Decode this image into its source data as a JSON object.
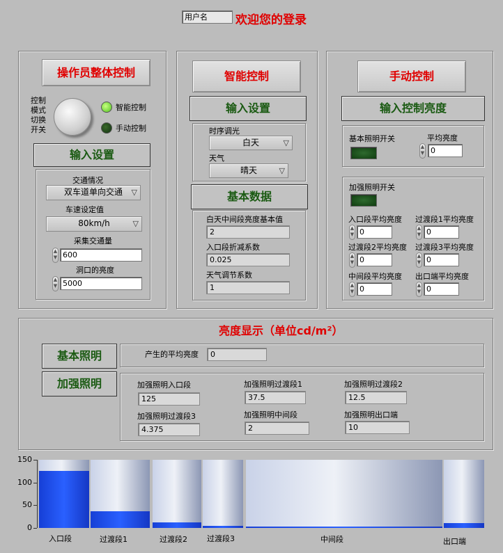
{
  "header": {
    "username_value": "用户名",
    "welcome": "欢迎您的登录"
  },
  "operator": {
    "title": "操作员整体控制",
    "switch_label": "控制模式切换开关",
    "options": [
      {
        "label": "智能控制",
        "on": true
      },
      {
        "label": "手动控制",
        "on": false
      }
    ],
    "input_header": "输入设置",
    "traffic_label": "交通情况",
    "traffic_value": "双车道单向交通",
    "speed_label": "车速设定值",
    "speed_value": "80km/h",
    "collect_label": "采集交通量",
    "collect_value": "600",
    "portal_label": "洞口的亮度",
    "portal_value": "5000"
  },
  "smart": {
    "title": "智能控制",
    "input_header": "输入设置",
    "timing_label": "时序调光",
    "timing_value": "白天",
    "weather_label": "天气",
    "weather_value": "晴天",
    "basic_header": "基本数据",
    "mid_base_label": "白天中间段亮度基本值",
    "mid_base_value": "2",
    "entry_coef_label": "入口段折减系数",
    "entry_coef_value": "0.025",
    "weather_coef_label": "天气调节系数",
    "weather_coef_value": "1"
  },
  "manual": {
    "title": "手动控制",
    "input_header": "输入控制亮度",
    "basic_switch_label": "基本照明开关",
    "avg_label": "平均亮度",
    "avg_value": "0",
    "enh_switch_label": "加强照明开关",
    "fields": [
      {
        "label": "入口段平均亮度",
        "value": "0"
      },
      {
        "label": "过渡段1平均亮度",
        "value": "0"
      },
      {
        "label": "过渡段2平均亮度",
        "value": "0"
      },
      {
        "label": "过渡段3平均亮度",
        "value": "0"
      },
      {
        "label": "中间段平均亮度",
        "value": "0"
      },
      {
        "label": "出口端平均亮度",
        "value": "0"
      }
    ]
  },
  "display": {
    "title": "亮度显示（单位cd/m²）",
    "basic_header": "基本照明",
    "avg_label": "产生的平均亮度",
    "avg_value": "0",
    "enh_header": "加强照明",
    "fields": [
      {
        "label": "加强照明入口段",
        "value": "125"
      },
      {
        "label": "加强照明过渡段1",
        "value": "37.5"
      },
      {
        "label": "加强照明过渡段2",
        "value": "12.5"
      },
      {
        "label": "加强照明过渡段3",
        "value": "4.375"
      },
      {
        "label": "加强照明中间段",
        "value": "2"
      },
      {
        "label": "加强照明出口端",
        "value": "10"
      }
    ]
  },
  "chart_data": {
    "type": "bar",
    "ylim": [
      0,
      150
    ],
    "yticks": [
      "150",
      "100",
      "50",
      "0"
    ],
    "categories": [
      "入口段",
      "过渡段1",
      "过渡段2",
      "过渡段3",
      "中间段",
      "出口端"
    ],
    "values": [
      125,
      37.5,
      12.5,
      4.375,
      2,
      10
    ]
  }
}
